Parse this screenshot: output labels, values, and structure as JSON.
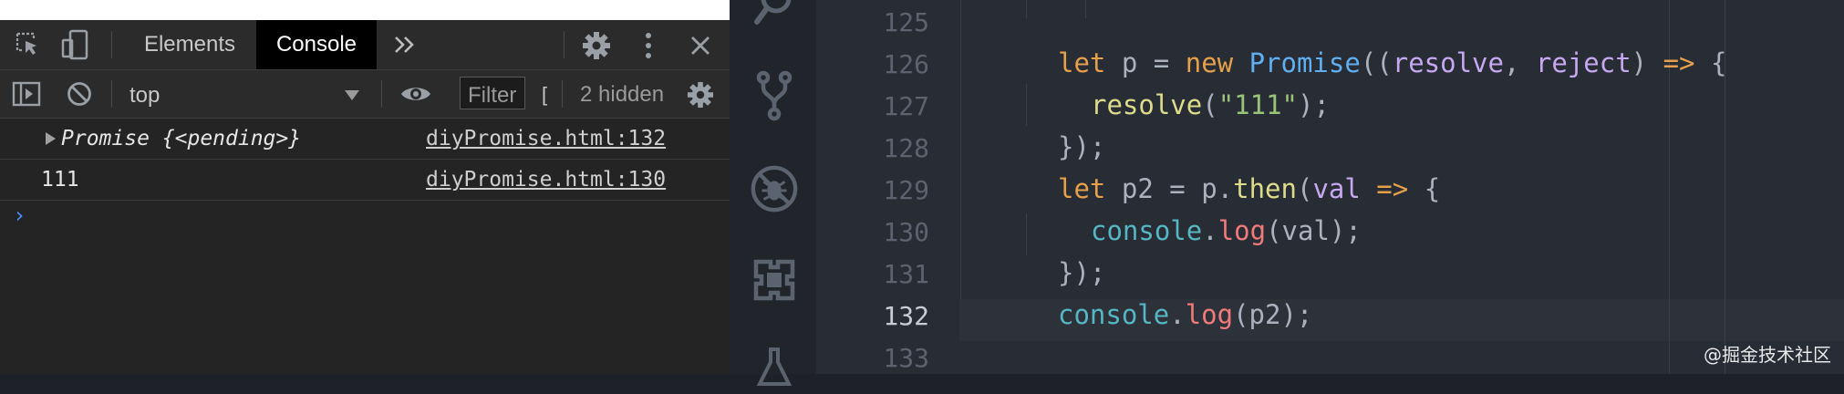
{
  "devtools": {
    "tabs": [
      {
        "label": "Elements",
        "active": false
      },
      {
        "label": "Console",
        "active": true
      }
    ],
    "context_select": "top",
    "filter_placeholder": "Filter",
    "filter_truncated": "[",
    "hidden_count": "2 hidden",
    "messages": [
      {
        "text": "Promise {<pending>}",
        "source": "diyPromise.html:132",
        "expandable": true
      },
      {
        "text": "111",
        "source": "diyPromise.html:130",
        "expandable": false
      }
    ],
    "prompt": "›"
  },
  "editor": {
    "line_numbers": [
      "125",
      "126",
      "127",
      "128",
      "129",
      "130",
      "131",
      "132",
      "133"
    ],
    "current_line": "132",
    "code": {
      "l126": [
        "let",
        "p",
        "=",
        "new",
        "Promise",
        "((",
        "resolve",
        ",",
        "reject",
        ")",
        "=>",
        "{"
      ],
      "l127": [
        "resolve",
        "(",
        "\"111\"",
        ");"
      ],
      "l128": "});",
      "l129": [
        "let",
        "p2",
        "=",
        "p",
        ".",
        "then",
        "(",
        "val",
        "=>",
        "{"
      ],
      "l130": [
        "console",
        ".",
        "log",
        "(val);"
      ],
      "l131": "});",
      "l132": [
        "console",
        ".",
        "log",
        "(p2);"
      ]
    },
    "activity_icons": [
      "search-icon",
      "source-control-icon",
      "debug-disabled-icon",
      "extensions-icon",
      "flask-icon"
    ]
  },
  "watermark": "@掘金技术社区",
  "colors": {
    "keyword": "#e5a04b",
    "class": "#61afef",
    "function": "#dcdc8b",
    "param": "#c6a8f0",
    "string": "#98c379",
    "object": "#56b6c2",
    "method": "#ef7b7b",
    "console_prompt": "#4c8dff"
  }
}
